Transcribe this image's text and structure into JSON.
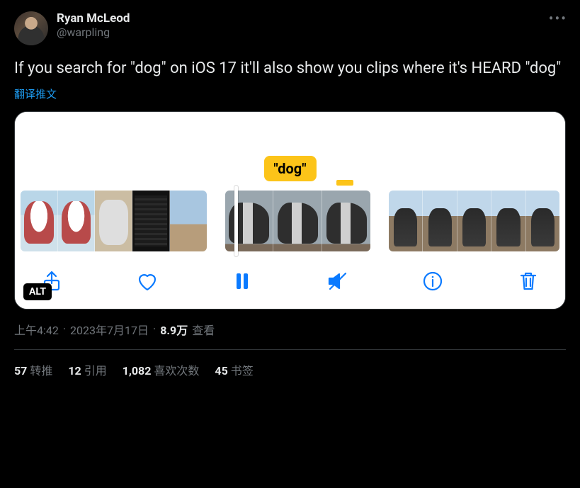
{
  "author": {
    "display_name": "Ryan McLeod",
    "handle": "@warpling"
  },
  "tweet_text": "If you search for \"dog\" on iOS 17 it'll also show you clips where it's HEARD \"dog\"",
  "translate_label": "翻译推文",
  "media": {
    "caption_chip": "\"dog\"",
    "alt_badge": "ALT",
    "toolbar_icons": [
      "share",
      "heart",
      "pause",
      "mute",
      "info",
      "trash"
    ]
  },
  "meta": {
    "time": "上午4:42",
    "dot1": "·",
    "date": "2023年7月17日",
    "dot2": "·",
    "views_value": "8.9万",
    "views_label": "查看"
  },
  "stats": {
    "retweets_count": "57",
    "retweets_label": "转推",
    "quotes_count": "12",
    "quotes_label": "引用",
    "likes_count": "1,082",
    "likes_label": "喜欢次数",
    "bookmarks_count": "45",
    "bookmarks_label": "书签"
  }
}
